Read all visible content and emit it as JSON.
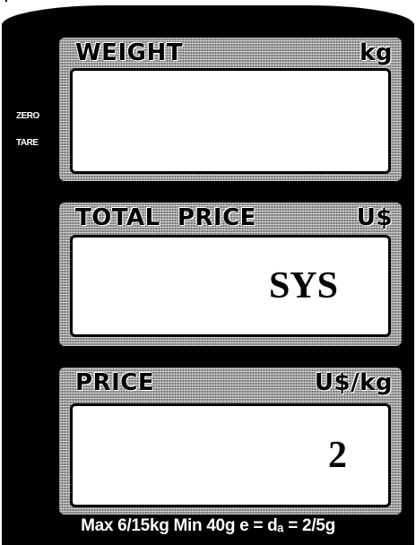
{
  "indicators": {
    "zero": "ZERO",
    "tare": "TARE"
  },
  "weight": {
    "title": "WEIGHT",
    "unit": "kg",
    "value": ""
  },
  "total_price": {
    "title": "TOTAL  PRICE",
    "unit": "U$",
    "value": "SYS"
  },
  "price": {
    "title": "PRICE",
    "unit": "U$/kg",
    "value": "2"
  },
  "spec_line": "Max 6/15kg  Min 40g  e = dₐ = 2/5g",
  "colors": {
    "panel": "#000000",
    "section_fill": "#9a9a9a",
    "lcd": "#ffffff"
  }
}
